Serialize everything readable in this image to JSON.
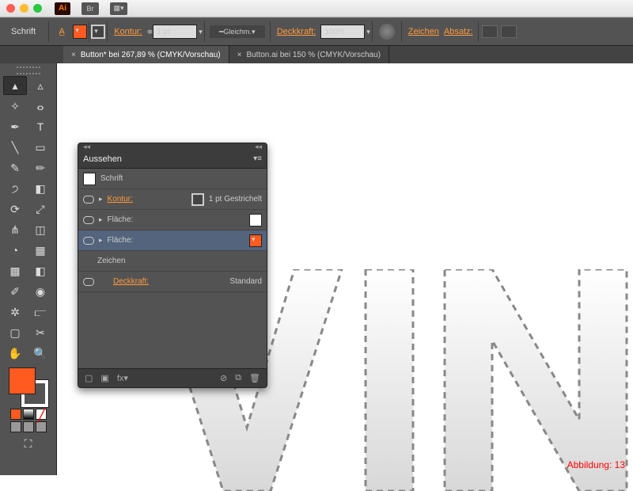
{
  "ai_badge": "Ai",
  "mac_btn_1": "Br",
  "mac_btn_2": "▦▾",
  "ctrl": {
    "mode": "Schrift",
    "kontur_label": "Kontur:",
    "stroke_val": "1 pt",
    "dash_label": "Gleichm.",
    "deckkraft_label": "Deckkraft:",
    "opacity_val": "100%",
    "zeichen": "Zeichen",
    "absatz": "Absatz:"
  },
  "tabs": {
    "t1": "Button* bei 267,89 % (CMYK/Vorschau)",
    "t2": "Button.ai bei 150 % (CMYK/Vorschau)"
  },
  "panel": {
    "title": "Aussehen",
    "row_schrift": "Schrift",
    "row_kontur": "Kontur:",
    "row_kontur_val": "1 pt Gestrichelt",
    "row_flaeche": "Fläche:",
    "row_zeichen": "Zeichen",
    "row_deckkraft": "Deckkraft:",
    "row_deckkraft_val": "Standard",
    "fx": "fx▾"
  },
  "colors": {
    "orange": "#ff5a1f",
    "panel_bg": "#535353"
  },
  "caption": "Abbildung: 13",
  "canvas_text": "VIN"
}
